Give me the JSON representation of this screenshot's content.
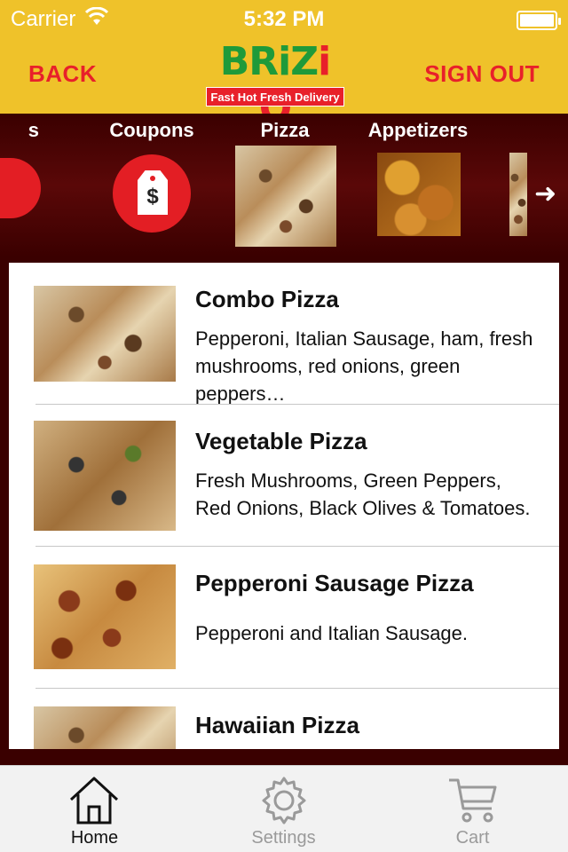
{
  "status_bar": {
    "carrier": "Carrier",
    "time": "5:32 PM"
  },
  "header": {
    "back_label": "BACK",
    "signout_label": "SIGN OUT",
    "logo_text": "BRiZiO",
    "logo_tagline": "Fast Hot Fresh Delivery"
  },
  "categories": [
    {
      "label": "s"
    },
    {
      "label": "Coupons"
    },
    {
      "label": "Pizza"
    },
    {
      "label": "Appetizers"
    }
  ],
  "menu_items": [
    {
      "title": "Combo Pizza",
      "description": "Pepperoni, Italian Sausage, ham, fresh mushrooms, red onions, green peppers…"
    },
    {
      "title": "Vegetable Pizza",
      "description": "Fresh Mushrooms, Green Peppers, Red Onions, Black Olives & Tomatoes."
    },
    {
      "title": "Pepperoni Sausage Pizza",
      "description": "Pepperoni and Italian Sausage."
    },
    {
      "title": "Hawaiian Pizza",
      "description": ""
    }
  ],
  "tabs": [
    {
      "label": "Home",
      "icon": "home-icon",
      "active": true
    },
    {
      "label": "Settings",
      "icon": "gear-icon",
      "active": false
    },
    {
      "label": "Cart",
      "icon": "cart-icon",
      "active": false
    }
  ],
  "colors": {
    "header_bg": "#efc22a",
    "accent_red": "#e8202a",
    "dark_bg": "#3a0000"
  }
}
